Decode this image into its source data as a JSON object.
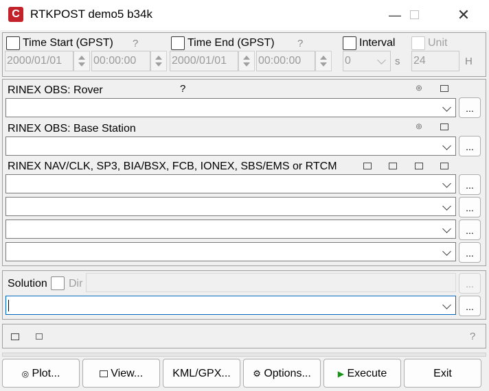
{
  "window": {
    "title": "RTKPOST demo5 b34k",
    "app_icon_letter": "C"
  },
  "time": {
    "start_label": "Time Start (GPST)",
    "start_help": "?",
    "start_date": "2000/01/01",
    "start_time": "00:00:00",
    "end_label": "Time End (GPST)",
    "end_help": "?",
    "end_date": "2000/01/01",
    "end_time": "00:00:00",
    "interval_label": "Interval",
    "interval_value": "0",
    "interval_unit": "s",
    "unit_label": "Unit",
    "unit_value": "24",
    "unit_suffix": "H"
  },
  "inputs": {
    "rover_label": "RINEX OBS: Rover",
    "rover_help": "?",
    "base_label": "RINEX OBS: Base Station",
    "nav_label": "RINEX NAV/CLK, SP3, BIA/BSX, FCB, IONEX, SBS/EMS  or RTCM",
    "browse": "..."
  },
  "solution": {
    "label": "Solution",
    "dir_label": "Dir",
    "browse": "..."
  },
  "status": {
    "help": "?"
  },
  "buttons": {
    "plot": "Plot...",
    "view": "View...",
    "kml": "KML/GPX...",
    "options": "Options...",
    "execute": "Execute",
    "exit": "Exit"
  },
  "icons": {
    "plot": "globe-icon",
    "view": "file-icon",
    "options": "gear-icon",
    "execute": "play-icon"
  },
  "colors": {
    "app_icon": "#c4222a",
    "execute_icon": "#1a8f1a",
    "focus": "#0067c0"
  }
}
